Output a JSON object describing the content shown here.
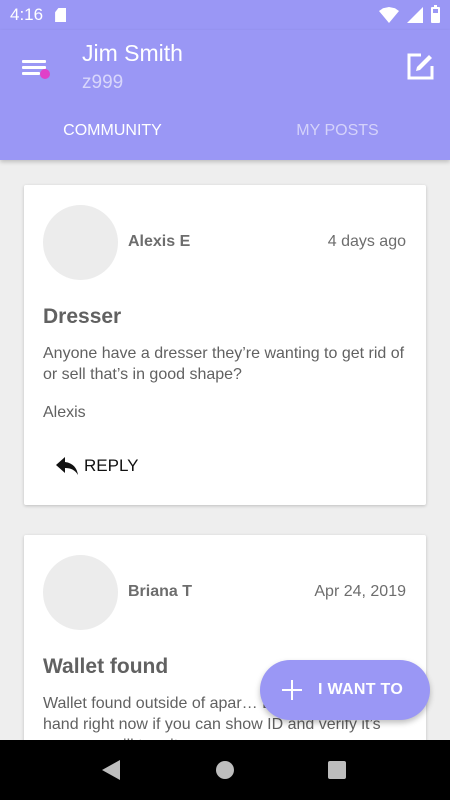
{
  "status_bar": {
    "time": "4:16",
    "icons": [
      "sd-card-icon",
      "wifi-icon",
      "signal-icon",
      "battery-icon"
    ]
  },
  "header": {
    "user_name": "Jim Smith",
    "user_id": "z999",
    "accent_color": "#9a97f5",
    "notification_dot_color": "#e040c8"
  },
  "tabs": [
    {
      "label": "COMMUNITY",
      "active": true
    },
    {
      "label": "MY POSTS",
      "active": false
    }
  ],
  "posts": [
    {
      "author": "Alexis E",
      "date": "4 days ago",
      "title": "Dresser",
      "body": "Anyone have a dresser they’re wanting to get rid of or sell that’s in good shape?",
      "signature": "Alexis",
      "reply_label": "REPLY"
    },
    {
      "author": "Briana T",
      "date": "Apr 24, 2019",
      "title": "Wallet found",
      "body": "Wallet found outside of apar… B! We’ve got it in hand right now if you can show ID and verify it’s yours we will turn it over."
    }
  ],
  "fab": {
    "label": "I WANT TO"
  }
}
